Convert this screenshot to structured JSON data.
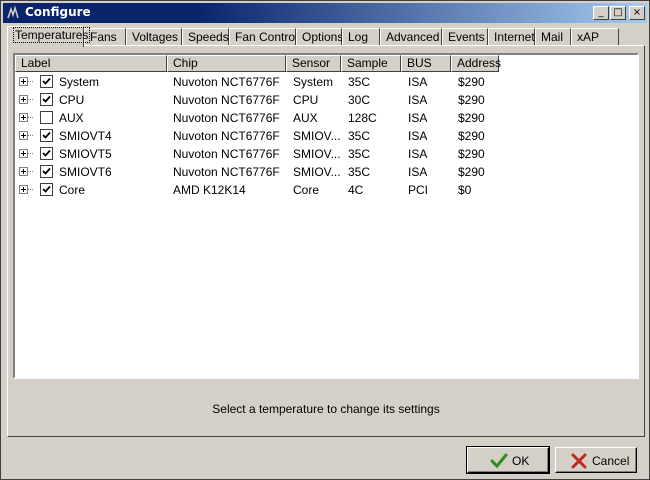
{
  "window": {
    "title": "Configure"
  },
  "title_buttons": {
    "minimize": "_",
    "maximize": "□",
    "close": "×"
  },
  "tabs": [
    {
      "label": "Temperatures",
      "active": true
    },
    {
      "label": "Fans"
    },
    {
      "label": "Voltages"
    },
    {
      "label": "Speeds"
    },
    {
      "label": "Fan Control"
    },
    {
      "label": "Options"
    },
    {
      "label": "Log"
    },
    {
      "label": "Advanced"
    },
    {
      "label": "Events"
    },
    {
      "label": "Internet"
    },
    {
      "label": "Mail"
    },
    {
      "label": "xAP"
    }
  ],
  "table": {
    "columns": [
      "Label",
      "Chip",
      "Sensor",
      "Sample",
      "BUS",
      "Address"
    ],
    "rows": [
      {
        "checked": true,
        "label": "System",
        "chip": "Nuvoton NCT6776F",
        "sensor": "System",
        "sample": "35C",
        "bus": "ISA",
        "address": "$290"
      },
      {
        "checked": true,
        "label": "CPU",
        "chip": "Nuvoton NCT6776F",
        "sensor": "CPU",
        "sample": "30C",
        "bus": "ISA",
        "address": "$290"
      },
      {
        "checked": false,
        "label": "AUX",
        "chip": "Nuvoton NCT6776F",
        "sensor": "AUX",
        "sample": "128C",
        "bus": "ISA",
        "address": "$290"
      },
      {
        "checked": true,
        "label": "SMIOVT4",
        "chip": "Nuvoton NCT6776F",
        "sensor": "SMIOV...",
        "sample": "35C",
        "bus": "ISA",
        "address": "$290"
      },
      {
        "checked": true,
        "label": "SMIOVT5",
        "chip": "Nuvoton NCT6776F",
        "sensor": "SMIOV...",
        "sample": "35C",
        "bus": "ISA",
        "address": "$290"
      },
      {
        "checked": true,
        "label": "SMIOVT6",
        "chip": "Nuvoton NCT6776F",
        "sensor": "SMIOV...",
        "sample": "35C",
        "bus": "ISA",
        "address": "$290"
      },
      {
        "checked": true,
        "label": "Core",
        "chip": "AMD K12K14",
        "sensor": "Core",
        "sample": "4C",
        "bus": "PCI",
        "address": "$0"
      }
    ]
  },
  "status_text": "Select a temperature to change its settings",
  "buttons": {
    "ok": "OK",
    "cancel": "Cancel"
  },
  "icons": {
    "ok": "check-icon",
    "cancel": "x-icon"
  },
  "colors": {
    "titlebar": "#0a246a",
    "ok_icon": "#2e8b1e",
    "cancel_icon": "#c0281e"
  }
}
